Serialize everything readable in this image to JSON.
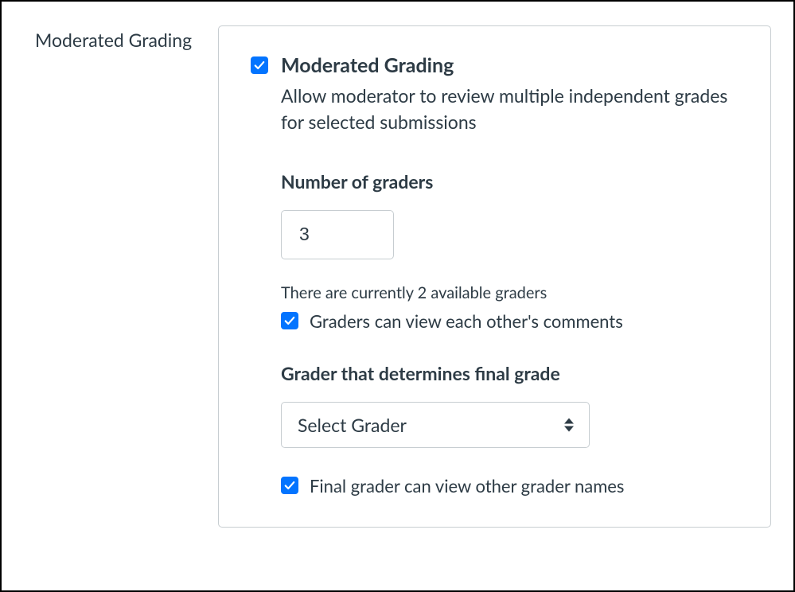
{
  "section_label": "Moderated Grading",
  "main_option": {
    "title": "Moderated Grading",
    "description": "Allow moderator to review multiple independent grades for selected submissions",
    "checked": true
  },
  "graders": {
    "heading": "Number of graders",
    "value": "3",
    "hint": "There are currently 2 available graders"
  },
  "view_comments": {
    "label": "Graders can view each other's comments",
    "checked": true
  },
  "final_grader": {
    "heading": "Grader that determines final grade",
    "selected": "Select Grader"
  },
  "final_view_names": {
    "label": "Final grader can view other grader names",
    "checked": true
  }
}
